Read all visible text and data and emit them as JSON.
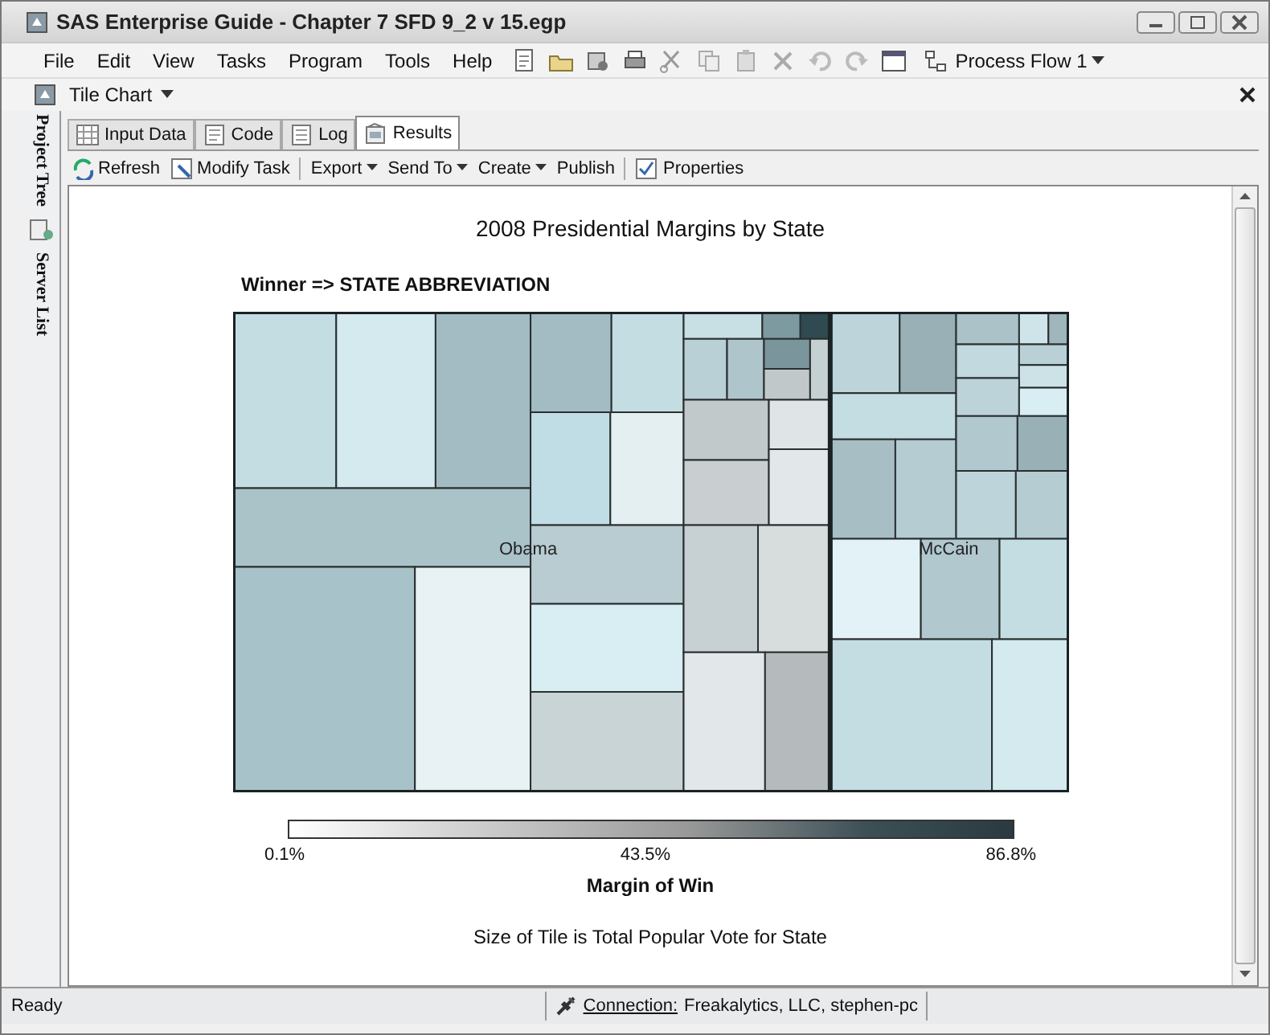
{
  "window": {
    "title": "SAS Enterprise Guide - Chapter 7 SFD 9_2 v 15.egp"
  },
  "menu": [
    "File",
    "Edit",
    "View",
    "Tasks",
    "Program",
    "Tools",
    "Help"
  ],
  "toolbar": {
    "process_flow": "Process Flow 1"
  },
  "panel": {
    "title": "Tile Chart"
  },
  "side_tabs": [
    "Project Tree",
    "Server List"
  ],
  "tabs": [
    {
      "label": "Input Data",
      "selected": false
    },
    {
      "label": "Code",
      "selected": false
    },
    {
      "label": "Log",
      "selected": false
    },
    {
      "label": "Results",
      "selected": true
    }
  ],
  "actions": [
    {
      "label": "Refresh",
      "dropdown": false
    },
    {
      "label": "Modify Task",
      "dropdown": false
    },
    {
      "label": "Export",
      "dropdown": true
    },
    {
      "label": "Send To",
      "dropdown": true
    },
    {
      "label": "Create",
      "dropdown": true
    },
    {
      "label": "Publish",
      "dropdown": false
    },
    {
      "label": "Properties",
      "dropdown": false
    }
  ],
  "report": {
    "title": "2008 Presidential Margins by State",
    "subtitle": "Winner => STATE ABBREVIATION",
    "groups": [
      "Obama",
      "McCain"
    ],
    "legend": {
      "ticks": [
        "0.1%",
        "43.5%",
        "86.8%"
      ],
      "title": "Margin of Win"
    },
    "footnote": "Size of Tile is Total Popular Vote for State"
  },
  "status_bar": {
    "text": "Ready",
    "connection_label": "Connection:",
    "connection": "Freakalytics, LLC, stephen-pc"
  }
}
